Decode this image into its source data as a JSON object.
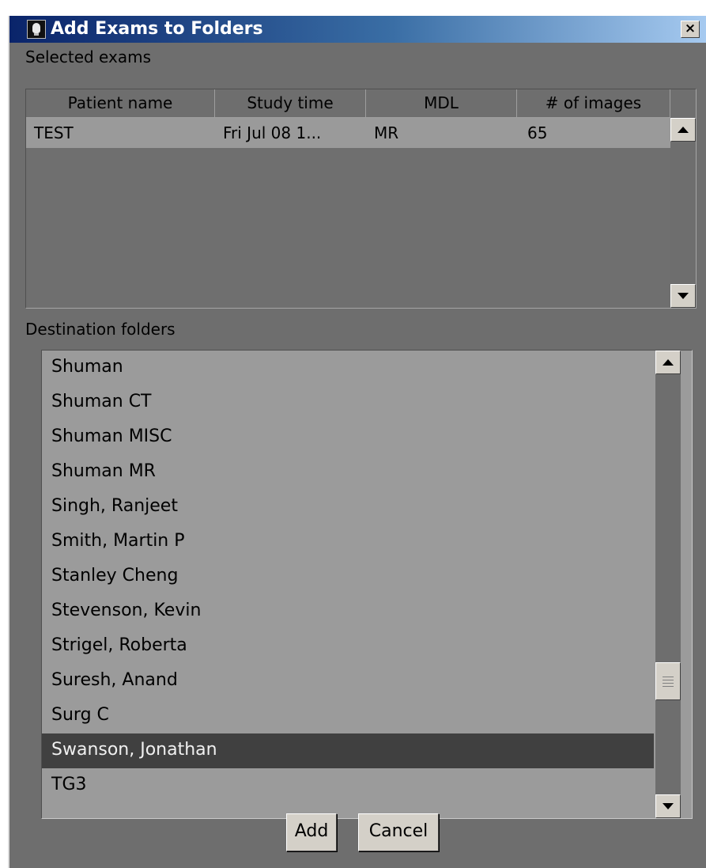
{
  "window": {
    "title": "Add Exams to Folders",
    "close_glyph": "×",
    "icon": "lightbulb-icon"
  },
  "selected_exams": {
    "label": "Selected exams",
    "columns": [
      "Patient name",
      "Study time",
      "MDL",
      "# of images"
    ],
    "rows": [
      [
        "TEST",
        "Fri Jul 08 1...",
        "MR",
        "65"
      ]
    ]
  },
  "destination": {
    "label": "Destination folders",
    "items": [
      "Shuman",
      "Shuman CT",
      "Shuman MISC",
      "Shuman MR",
      "Singh, Ranjeet",
      "Smith, Martin P",
      "Stanley Cheng",
      "Stevenson, Kevin",
      "Strigel, Roberta",
      "Suresh, Anand",
      "Surg C",
      "Swanson, Jonathan",
      "TG3"
    ],
    "selected": "Swanson, Jonathan"
  },
  "buttons": {
    "add": "Add",
    "cancel": "Cancel"
  },
  "colors": {
    "title_bar_start": "#0a246a",
    "title_bar_end": "#a6caf0",
    "selection": "#404040",
    "panel": "#6e6e6e"
  }
}
